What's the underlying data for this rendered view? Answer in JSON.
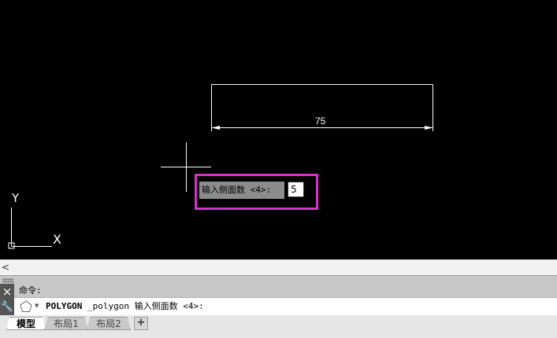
{
  "drawing": {
    "dimension_value": "75",
    "ucs_x_label": "X",
    "ucs_y_label": "Y"
  },
  "dynamic_input": {
    "prompt": "输入侧面数 <4>:",
    "value": "5",
    "highlight_color": "#d633c8"
  },
  "scrollbar": {
    "left_arrow": "<"
  },
  "command_window": {
    "history_text": "命令:",
    "close_icon": "×",
    "wrench_icon": "🔧",
    "current_command": "POLYGON",
    "current_rest": " _polygon 输入侧面数 <4>:",
    "dropdown_arrow": "▼"
  },
  "tabs": {
    "model": "模型",
    "layout1": "布局1",
    "layout2": "布局2",
    "add": "+"
  }
}
